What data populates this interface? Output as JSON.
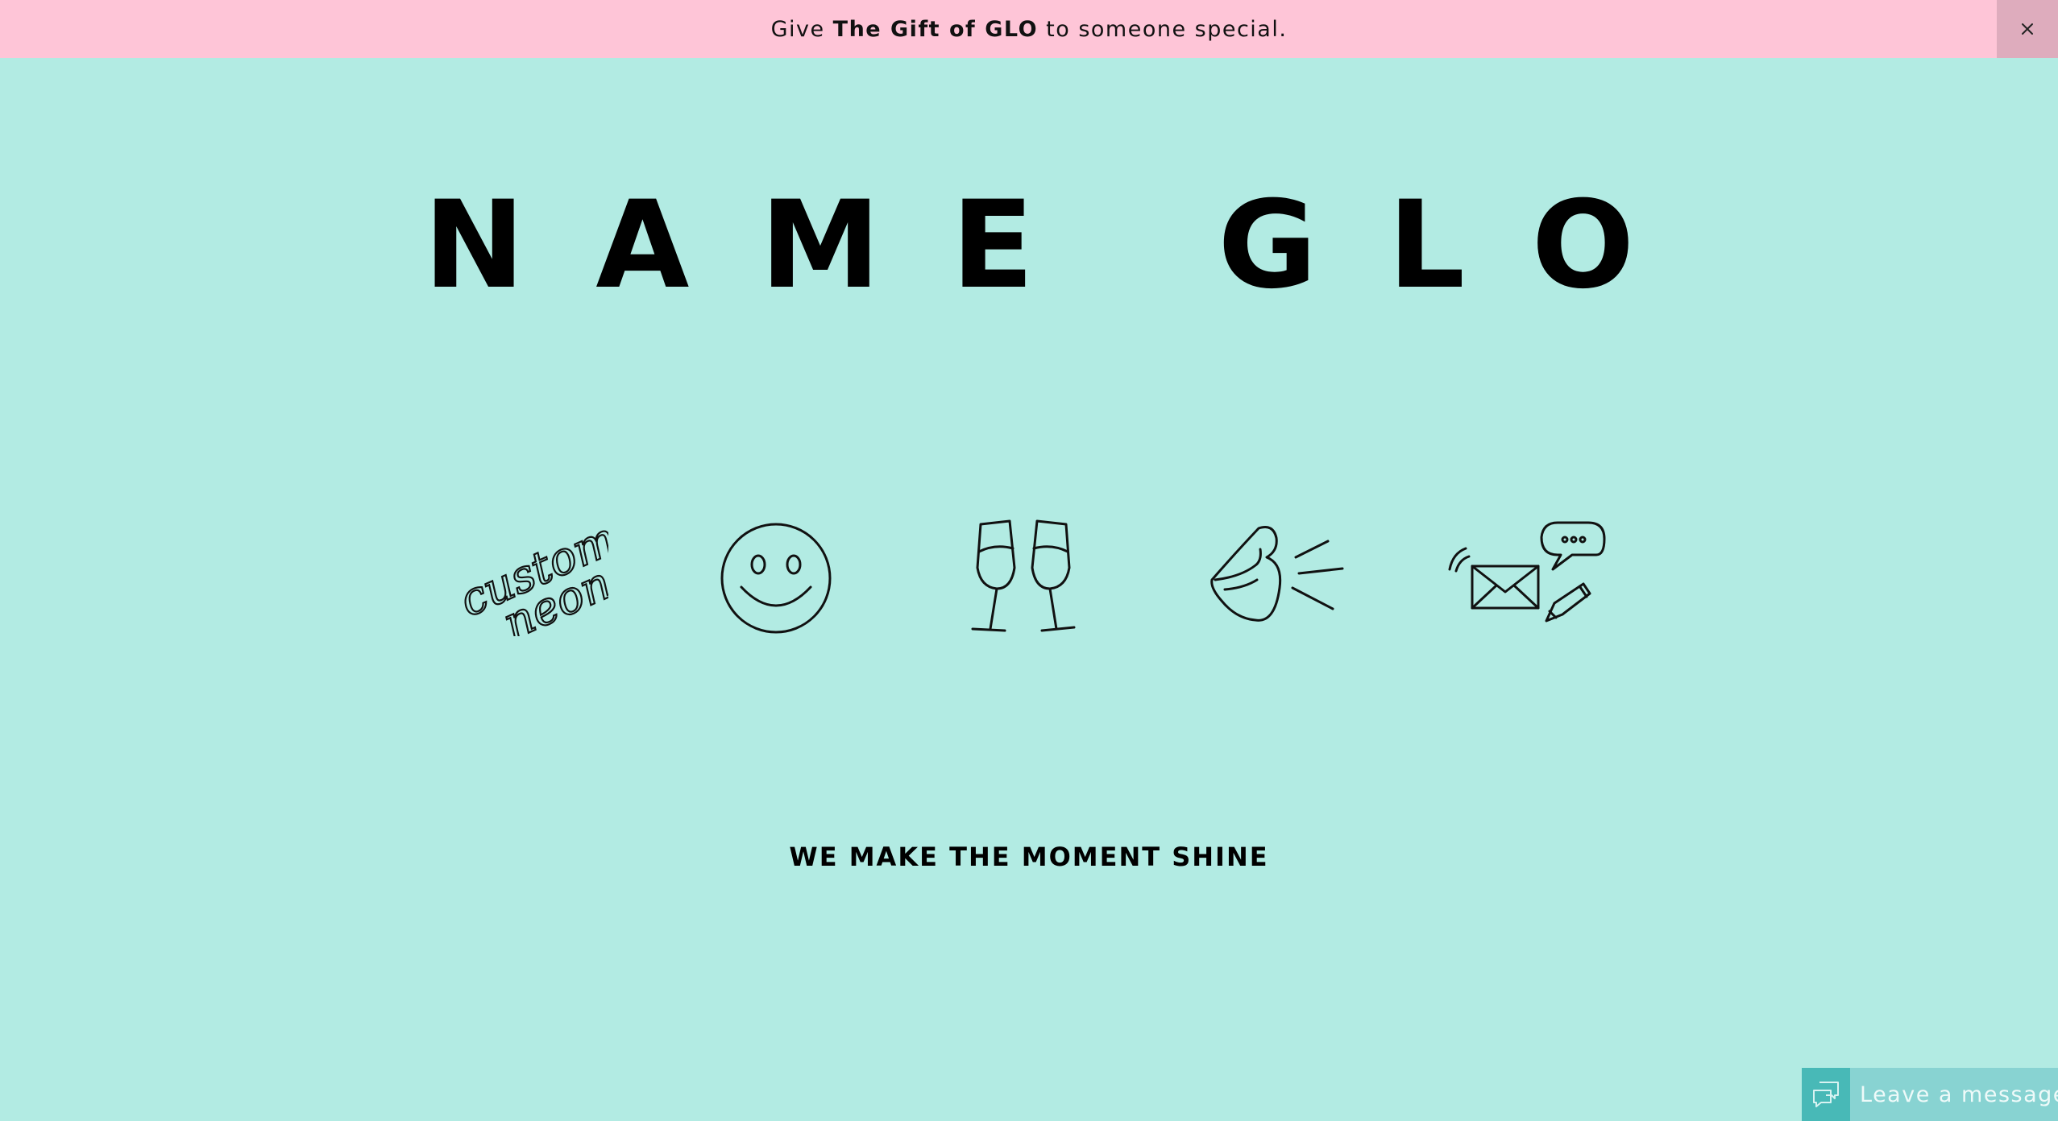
{
  "announcement": {
    "prefix": "Give ",
    "highlight": "The Gift of GLO",
    "suffix": " to someone special.",
    "close_label": "×"
  },
  "brand": {
    "title": "NAME GLO"
  },
  "icons": [
    {
      "name": "custom-neon-icon",
      "text_line1": "custom",
      "text_line2": "neon"
    },
    {
      "name": "smiley-face-icon"
    },
    {
      "name": "champagne-glasses-icon"
    },
    {
      "name": "lips-icon"
    },
    {
      "name": "contact-icon"
    }
  ],
  "tagline": "WE MAKE THE MOMENT SHINE",
  "chat": {
    "label": "Leave a message"
  },
  "colors": {
    "background": "#b2ebe3",
    "announcement_bg": "#fec5d7",
    "close_bg": "#deacbd",
    "chat_bg": "#88d3d2",
    "chat_icon_bg": "#48b9b7"
  }
}
